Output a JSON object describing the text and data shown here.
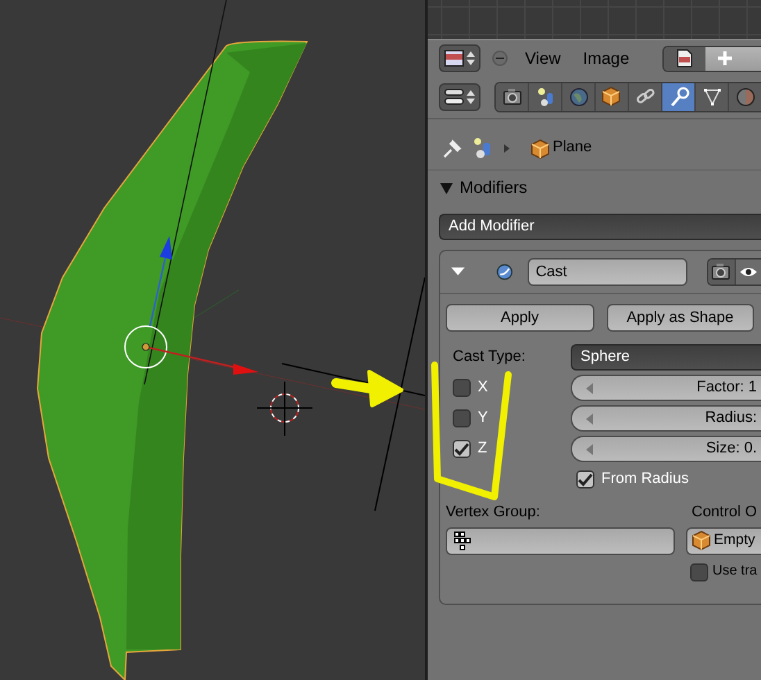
{
  "header": {
    "menus": [
      "View",
      "Image"
    ]
  },
  "property_tabs": [
    {
      "kind": "render",
      "selected": false
    },
    {
      "kind": "layers",
      "selected": false
    },
    {
      "kind": "world",
      "selected": false
    },
    {
      "kind": "object",
      "selected": false
    },
    {
      "kind": "constraints",
      "selected": false
    },
    {
      "kind": "modifiers",
      "selected": true
    },
    {
      "kind": "data",
      "selected": false
    },
    {
      "kind": "material",
      "selected": false
    }
  ],
  "breadcrumb": {
    "object": "Plane"
  },
  "panel": {
    "title": "Modifiers",
    "expanded": true,
    "add_modifier": "Add Modifier"
  },
  "modifier": {
    "name": "Cast",
    "expanded": true,
    "buttons": [
      "Apply",
      "Apply as Shape"
    ],
    "cast_type_label": "Cast Type:",
    "cast_type": "Sphere",
    "axes": [
      {
        "label": "X",
        "checked": false
      },
      {
        "label": "Y",
        "checked": false
      },
      {
        "label": "Z",
        "checked": true
      }
    ],
    "sliders": [
      "Factor: 1",
      "Radius:",
      "Size: 0."
    ],
    "from_radius": {
      "label": "From Radius",
      "checked": true
    },
    "vertex_group_label": "Vertex Group:",
    "control_object_label": "Control O",
    "control_object": "Empty",
    "use_transform": {
      "label": "Use tra",
      "checked": false
    }
  }
}
